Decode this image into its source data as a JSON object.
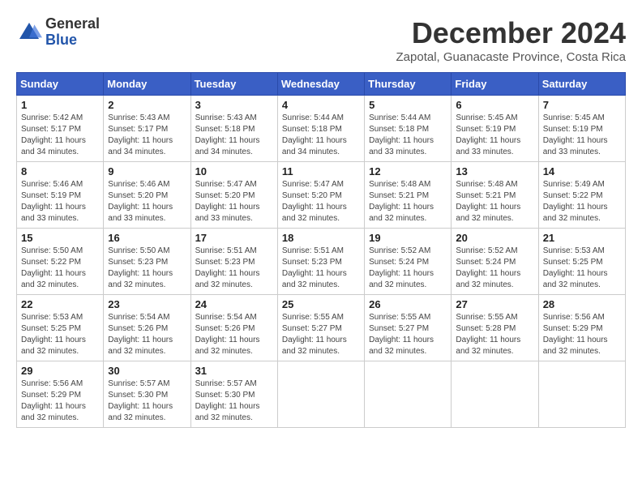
{
  "header": {
    "logo_general": "General",
    "logo_blue": "Blue",
    "month_title": "December 2024",
    "location": "Zapotal, Guanacaste Province, Costa Rica"
  },
  "calendar": {
    "days_of_week": [
      "Sunday",
      "Monday",
      "Tuesday",
      "Wednesday",
      "Thursday",
      "Friday",
      "Saturday"
    ],
    "weeks": [
      [
        {
          "day": "1",
          "sunrise": "5:42 AM",
          "sunset": "5:17 PM",
          "daylight": "11 hours and 34 minutes."
        },
        {
          "day": "2",
          "sunrise": "5:43 AM",
          "sunset": "5:17 PM",
          "daylight": "11 hours and 34 minutes."
        },
        {
          "day": "3",
          "sunrise": "5:43 AM",
          "sunset": "5:18 PM",
          "daylight": "11 hours and 34 minutes."
        },
        {
          "day": "4",
          "sunrise": "5:44 AM",
          "sunset": "5:18 PM",
          "daylight": "11 hours and 34 minutes."
        },
        {
          "day": "5",
          "sunrise": "5:44 AM",
          "sunset": "5:18 PM",
          "daylight": "11 hours and 33 minutes."
        },
        {
          "day": "6",
          "sunrise": "5:45 AM",
          "sunset": "5:19 PM",
          "daylight": "11 hours and 33 minutes."
        },
        {
          "day": "7",
          "sunrise": "5:45 AM",
          "sunset": "5:19 PM",
          "daylight": "11 hours and 33 minutes."
        }
      ],
      [
        {
          "day": "8",
          "sunrise": "5:46 AM",
          "sunset": "5:19 PM",
          "daylight": "11 hours and 33 minutes."
        },
        {
          "day": "9",
          "sunrise": "5:46 AM",
          "sunset": "5:20 PM",
          "daylight": "11 hours and 33 minutes."
        },
        {
          "day": "10",
          "sunrise": "5:47 AM",
          "sunset": "5:20 PM",
          "daylight": "11 hours and 33 minutes."
        },
        {
          "day": "11",
          "sunrise": "5:47 AM",
          "sunset": "5:20 PM",
          "daylight": "11 hours and 32 minutes."
        },
        {
          "day": "12",
          "sunrise": "5:48 AM",
          "sunset": "5:21 PM",
          "daylight": "11 hours and 32 minutes."
        },
        {
          "day": "13",
          "sunrise": "5:48 AM",
          "sunset": "5:21 PM",
          "daylight": "11 hours and 32 minutes."
        },
        {
          "day": "14",
          "sunrise": "5:49 AM",
          "sunset": "5:22 PM",
          "daylight": "11 hours and 32 minutes."
        }
      ],
      [
        {
          "day": "15",
          "sunrise": "5:50 AM",
          "sunset": "5:22 PM",
          "daylight": "11 hours and 32 minutes."
        },
        {
          "day": "16",
          "sunrise": "5:50 AM",
          "sunset": "5:23 PM",
          "daylight": "11 hours and 32 minutes."
        },
        {
          "day": "17",
          "sunrise": "5:51 AM",
          "sunset": "5:23 PM",
          "daylight": "11 hours and 32 minutes."
        },
        {
          "day": "18",
          "sunrise": "5:51 AM",
          "sunset": "5:23 PM",
          "daylight": "11 hours and 32 minutes."
        },
        {
          "day": "19",
          "sunrise": "5:52 AM",
          "sunset": "5:24 PM",
          "daylight": "11 hours and 32 minutes."
        },
        {
          "day": "20",
          "sunrise": "5:52 AM",
          "sunset": "5:24 PM",
          "daylight": "11 hours and 32 minutes."
        },
        {
          "day": "21",
          "sunrise": "5:53 AM",
          "sunset": "5:25 PM",
          "daylight": "11 hours and 32 minutes."
        }
      ],
      [
        {
          "day": "22",
          "sunrise": "5:53 AM",
          "sunset": "5:25 PM",
          "daylight": "11 hours and 32 minutes."
        },
        {
          "day": "23",
          "sunrise": "5:54 AM",
          "sunset": "5:26 PM",
          "daylight": "11 hours and 32 minutes."
        },
        {
          "day": "24",
          "sunrise": "5:54 AM",
          "sunset": "5:26 PM",
          "daylight": "11 hours and 32 minutes."
        },
        {
          "day": "25",
          "sunrise": "5:55 AM",
          "sunset": "5:27 PM",
          "daylight": "11 hours and 32 minutes."
        },
        {
          "day": "26",
          "sunrise": "5:55 AM",
          "sunset": "5:27 PM",
          "daylight": "11 hours and 32 minutes."
        },
        {
          "day": "27",
          "sunrise": "5:55 AM",
          "sunset": "5:28 PM",
          "daylight": "11 hours and 32 minutes."
        },
        {
          "day": "28",
          "sunrise": "5:56 AM",
          "sunset": "5:29 PM",
          "daylight": "11 hours and 32 minutes."
        }
      ],
      [
        {
          "day": "29",
          "sunrise": "5:56 AM",
          "sunset": "5:29 PM",
          "daylight": "11 hours and 32 minutes."
        },
        {
          "day": "30",
          "sunrise": "5:57 AM",
          "sunset": "5:30 PM",
          "daylight": "11 hours and 32 minutes."
        },
        {
          "day": "31",
          "sunrise": "5:57 AM",
          "sunset": "5:30 PM",
          "daylight": "11 hours and 32 minutes."
        },
        null,
        null,
        null,
        null
      ]
    ]
  }
}
